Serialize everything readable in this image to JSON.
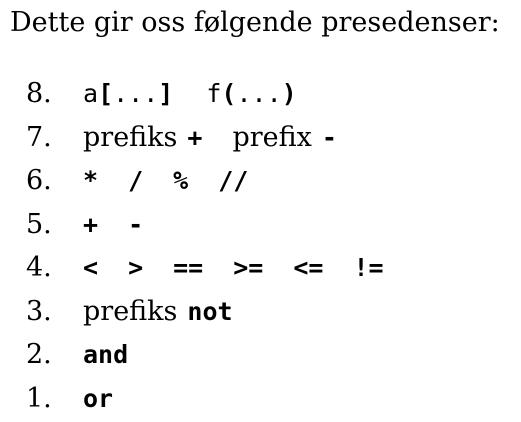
{
  "intro": "Dette gir oss følgende presedenser:",
  "rows": [
    {
      "number": "8.",
      "parts": [
        {
          "text": "a",
          "mono": true,
          "bold": false
        },
        {
          "text": "[",
          "mono": true,
          "bold": true
        },
        {
          "text": "...",
          "mono": true,
          "bold": false
        },
        {
          "text": "]",
          "mono": true,
          "bold": true
        },
        {
          "text": "f",
          "mono": true,
          "bold": false
        },
        {
          "text": "(",
          "mono": true,
          "bold": true
        },
        {
          "text": "...",
          "mono": true,
          "bold": false
        },
        {
          "text": ")",
          "mono": true,
          "bold": true
        }
      ]
    },
    {
      "number": "7.",
      "parts": [
        {
          "text": "prefiks",
          "mono": false,
          "bold": false
        },
        {
          "text": "+",
          "mono": true,
          "bold": true
        },
        {
          "text": "prefix",
          "mono": false,
          "bold": false
        },
        {
          "text": "-",
          "mono": true,
          "bold": true
        }
      ]
    },
    {
      "number": "6.",
      "parts": [
        {
          "text": "*",
          "mono": true,
          "bold": true
        },
        {
          "text": "/",
          "mono": true,
          "bold": true
        },
        {
          "text": "%",
          "mono": true,
          "bold": true
        },
        {
          "text": "//",
          "mono": true,
          "bold": true
        }
      ]
    },
    {
      "number": "5.",
      "parts": [
        {
          "text": "+",
          "mono": true,
          "bold": true
        },
        {
          "text": "-",
          "mono": true,
          "bold": true
        }
      ]
    },
    {
      "number": "4.",
      "parts": [
        {
          "text": "<",
          "mono": true,
          "bold": true
        },
        {
          "text": ">",
          "mono": true,
          "bold": true
        },
        {
          "text": "==",
          "mono": true,
          "bold": true
        },
        {
          "text": ">=",
          "mono": true,
          "bold": true
        },
        {
          "text": "<=",
          "mono": true,
          "bold": true
        },
        {
          "text": "!=",
          "mono": true,
          "bold": true
        }
      ]
    },
    {
      "number": "3.",
      "parts": [
        {
          "text": "prefiks",
          "mono": false,
          "bold": false
        },
        {
          "text": "not",
          "mono": true,
          "bold": true
        }
      ]
    },
    {
      "number": "2.",
      "parts": [
        {
          "text": "and",
          "mono": true,
          "bold": true
        }
      ]
    },
    {
      "number": "1.",
      "parts": [
        {
          "text": "or",
          "mono": true,
          "bold": true
        }
      ]
    }
  ]
}
